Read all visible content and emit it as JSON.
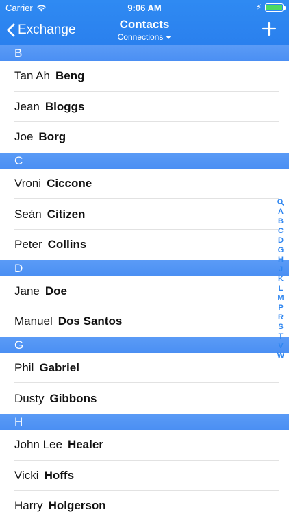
{
  "status": {
    "carrier": "Carrier",
    "time": "9:06 AM"
  },
  "nav": {
    "back_label": "Exchange",
    "title": "Contacts",
    "subtitle": "Connections"
  },
  "colors": {
    "nav_blue": "#2f8af2",
    "section_blue": "#5a9bf6",
    "index_blue": "#2f86f0",
    "battery_green": "#4cd964"
  },
  "sections": [
    {
      "letter": "B",
      "contacts": [
        {
          "first": "Tan Ah",
          "last": "Beng"
        },
        {
          "first": "Jean",
          "last": "Bloggs"
        },
        {
          "first": "Joe",
          "last": "Borg"
        }
      ]
    },
    {
      "letter": "C",
      "contacts": [
        {
          "first": "Vroni",
          "last": "Ciccone"
        },
        {
          "first": "Seán",
          "last": "Citizen"
        },
        {
          "first": "Peter",
          "last": "Collins"
        }
      ]
    },
    {
      "letter": "D",
      "contacts": [
        {
          "first": "Jane",
          "last": "Doe"
        },
        {
          "first": "Manuel",
          "last": "Dos Santos"
        }
      ]
    },
    {
      "letter": "G",
      "contacts": [
        {
          "first": "Phil",
          "last": "Gabriel"
        },
        {
          "first": "Dusty",
          "last": "Gibbons"
        }
      ]
    },
    {
      "letter": "H",
      "contacts": [
        {
          "first": "John Lee",
          "last": "Healer"
        },
        {
          "first": "Vicki",
          "last": "Hoffs"
        },
        {
          "first": "Harry",
          "last": "Holgerson"
        }
      ]
    }
  ],
  "index_letters": [
    "A",
    "B",
    "C",
    "D",
    "G",
    "H",
    "J",
    "K",
    "L",
    "M",
    "P",
    "R",
    "S",
    "T",
    "V",
    "W"
  ]
}
